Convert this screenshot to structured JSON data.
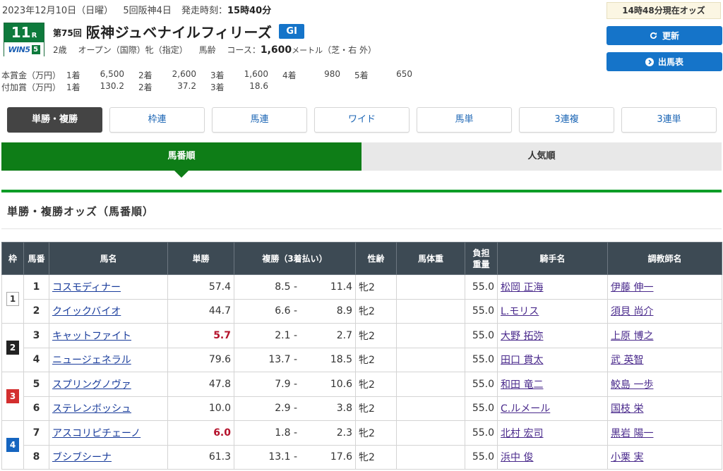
{
  "header": {
    "date": "2023年12月10日（日曜）",
    "meeting": "5回阪神4日",
    "start_label": "発走時刻：",
    "start_time": "15時40分"
  },
  "race": {
    "number": "11",
    "number_suffix": "R",
    "win5_label": "WIN5",
    "win5_leg": "5",
    "count": "第75回",
    "name": "阪神ジュベナイルフィリーズ",
    "grade": "GI",
    "conditions": [
      "2歳",
      "オープン（国際）牝（指定）",
      "馬齢"
    ],
    "course_label": "コース：",
    "distance": "1,600",
    "distance_unit": "メートル",
    "surface": "（芝・右 外）"
  },
  "prize": {
    "main_label": "本賞金（万円）",
    "main": [
      {
        "pos": "1着",
        "amt": "6,500"
      },
      {
        "pos": "2着",
        "amt": "2,600"
      },
      {
        "pos": "3着",
        "amt": "1,600"
      },
      {
        "pos": "4着",
        "amt": "980"
      },
      {
        "pos": "5着",
        "amt": "650"
      }
    ],
    "extra_label": "付加賞（万円）",
    "extra": [
      {
        "pos": "1着",
        "amt": "130.2"
      },
      {
        "pos": "2着",
        "amt": "37.2"
      },
      {
        "pos": "3着",
        "amt": "18.6"
      }
    ]
  },
  "side": {
    "odds_time": "14時48分現在オッズ",
    "refresh_label": "更新",
    "entries_label": "出馬表"
  },
  "bet_tabs": [
    "単勝・複勝",
    "枠連",
    "馬連",
    "ワイド",
    "馬単",
    "3連複",
    "3連単"
  ],
  "sort_tabs": [
    "馬番順",
    "人気順"
  ],
  "section_title": "単勝・複勝オッズ（馬番順）",
  "table": {
    "headers": {
      "waku": "枠",
      "num": "馬番",
      "name": "馬名",
      "win": "単勝",
      "place": "複勝（3着払い）",
      "sex_age": "性齢",
      "body_weight": "馬体重",
      "weight_1": "負担",
      "weight_2": "重量",
      "jockey": "騎手名",
      "trainer": "調教師名"
    },
    "rows": [
      {
        "waku": "1",
        "num": "1",
        "name": "コスモディナー",
        "win": "57.4",
        "pmin": "8.5",
        "pmax": "11.4",
        "sex": "牝2",
        "wt": "55.0",
        "jockey": "松岡 正海",
        "trainer": "伊藤 伸一"
      },
      {
        "waku": "",
        "num": "2",
        "name": "クイックバイオ",
        "win": "44.7",
        "pmin": "6.6",
        "pmax": "8.9",
        "sex": "牝2",
        "wt": "55.0",
        "jockey": "L.モリス",
        "trainer": "須貝 尚介"
      },
      {
        "waku": "2",
        "num": "3",
        "name": "キャットファイト",
        "win": "5.7",
        "pmin": "2.1",
        "pmax": "2.7",
        "sex": "牝2",
        "wt": "55.0",
        "jockey": "大野 拓弥",
        "trainer": "上原 博之"
      },
      {
        "waku": "",
        "num": "4",
        "name": "ニュージェネラル",
        "win": "79.6",
        "pmin": "13.7",
        "pmax": "18.5",
        "sex": "牝2",
        "wt": "55.0",
        "jockey": "田口 貫太",
        "trainer": "武 英智"
      },
      {
        "waku": "3",
        "num": "5",
        "name": "スプリングノヴァ",
        "win": "47.8",
        "pmin": "7.9",
        "pmax": "10.6",
        "sex": "牝2",
        "wt": "55.0",
        "jockey": "和田 竜二",
        "trainer": "鮫島 一歩"
      },
      {
        "waku": "",
        "num": "6",
        "name": "ステレンボッシュ",
        "win": "10.0",
        "pmin": "2.9",
        "pmax": "3.8",
        "sex": "牝2",
        "wt": "55.0",
        "jockey": "C.ルメール",
        "trainer": "国枝 栄"
      },
      {
        "waku": "4",
        "num": "7",
        "name": "アスコリピチェーノ",
        "win": "6.0",
        "pmin": "1.8",
        "pmax": "2.3",
        "sex": "牝2",
        "wt": "55.0",
        "jockey": "北村 宏司",
        "trainer": "黒岩 陽一"
      },
      {
        "waku": "",
        "num": "8",
        "name": "ブシブシーナ",
        "win": "61.3",
        "pmin": "13.1",
        "pmax": "17.6",
        "sex": "牝2",
        "wt": "55.0",
        "jockey": "浜中 俊",
        "trainer": "小栗 実"
      }
    ],
    "place_separator": "-"
  },
  "colors": {
    "accent_green": "#0e7d17",
    "blue": "#1574c9",
    "favorite_red": "#b4122b",
    "header_dark": "#3d4a54"
  }
}
